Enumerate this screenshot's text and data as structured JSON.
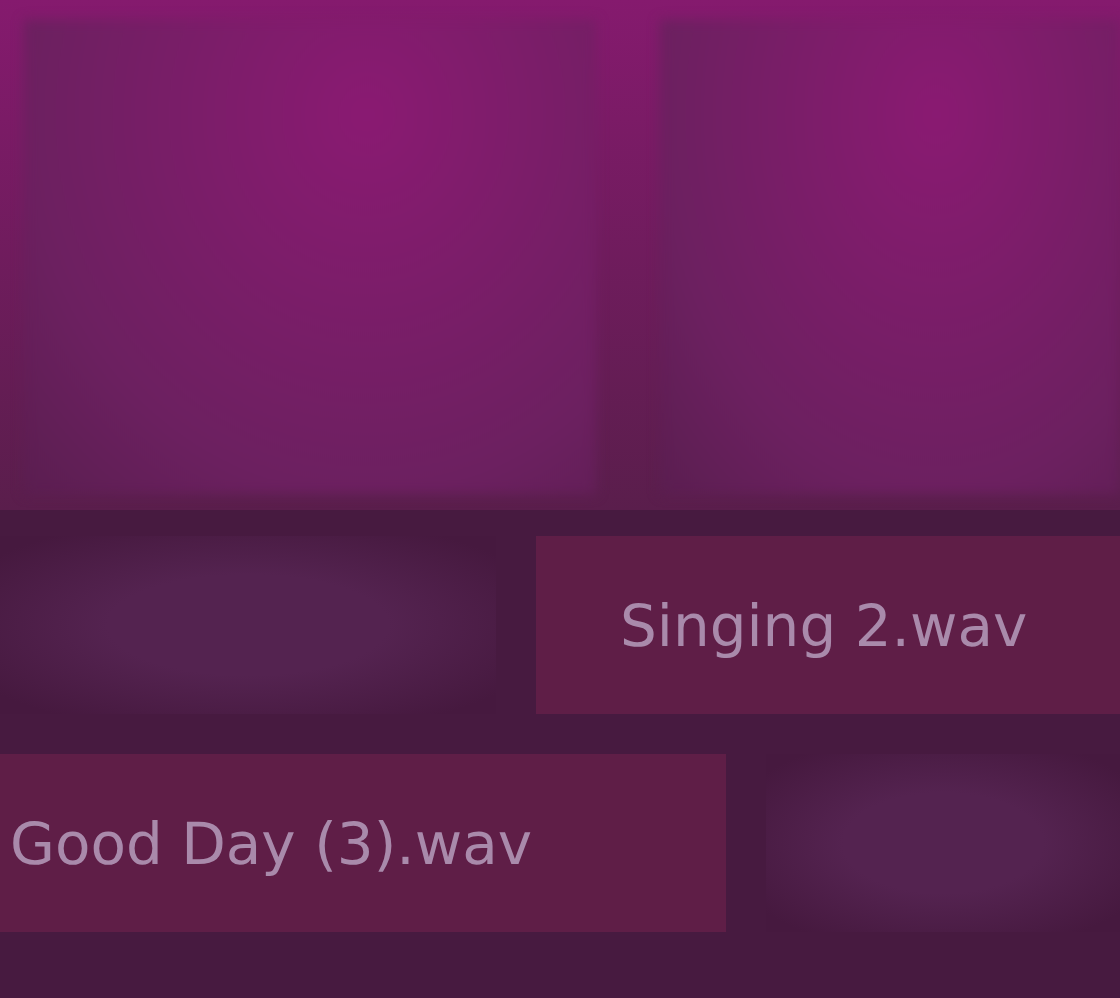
{
  "rows": [
    {
      "chips": [
        {
          "kind": "blurred"
        },
        {
          "kind": "file",
          "label": "Singing 2.wav"
        }
      ]
    },
    {
      "chips": [
        {
          "kind": "file",
          "label": "Good Day (3).wav"
        },
        {
          "kind": "blurred"
        }
      ]
    }
  ]
}
